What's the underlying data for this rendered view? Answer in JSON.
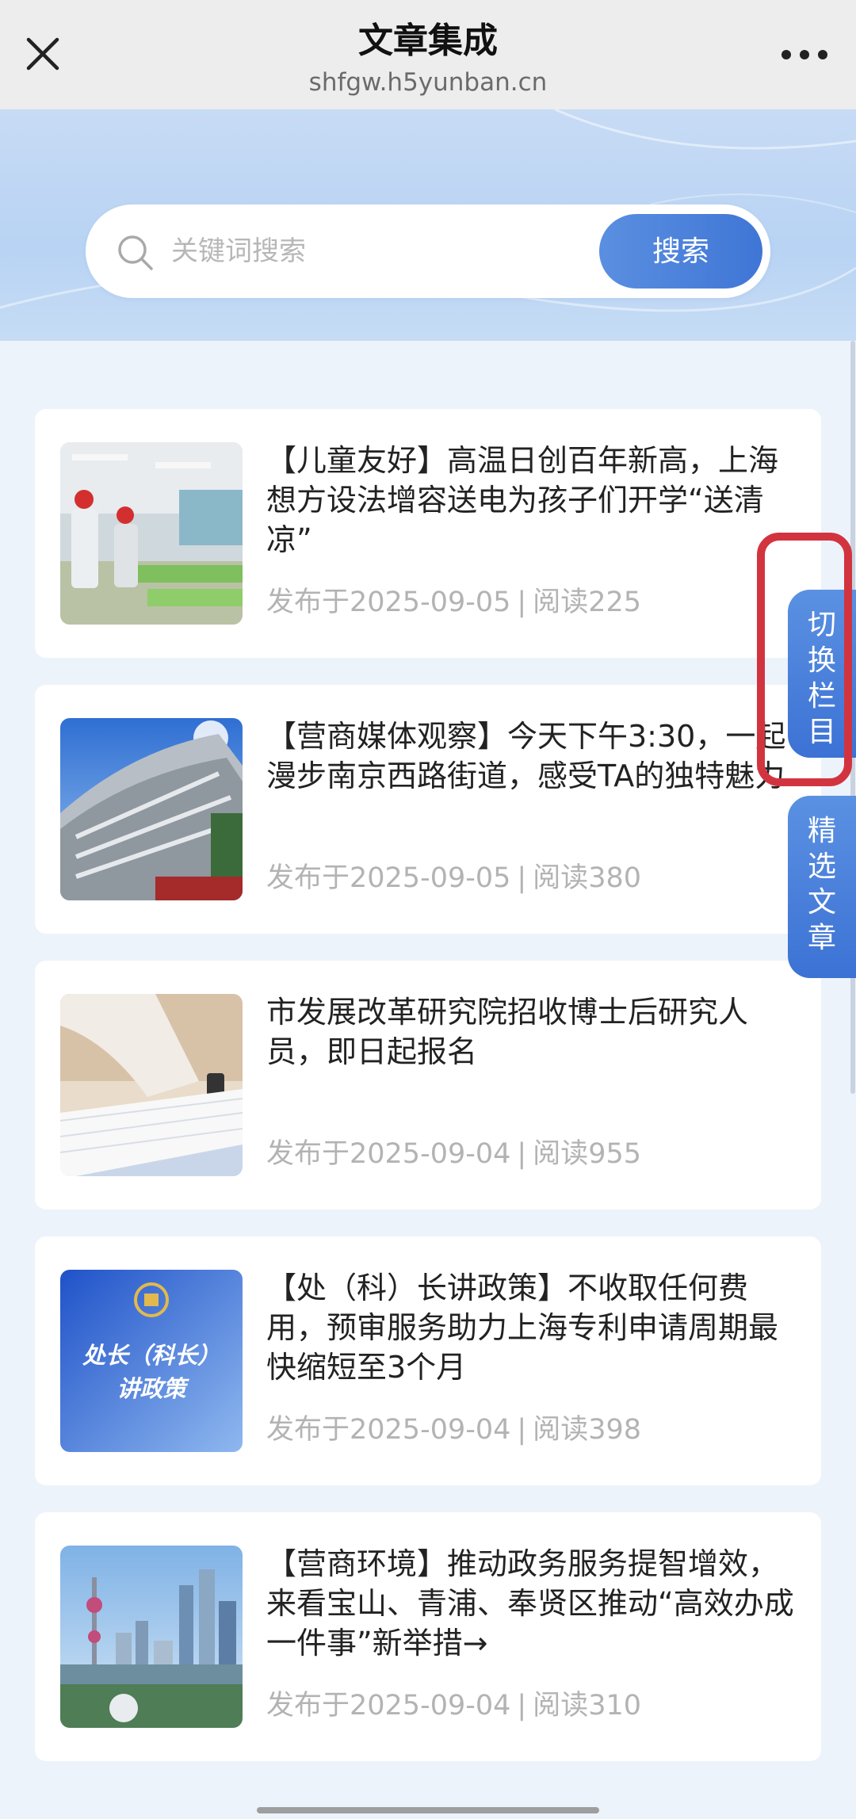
{
  "topbar": {
    "title": "文章集成",
    "url": "shfgw.h5yunban.cn"
  },
  "search": {
    "placeholder": "关键词搜索",
    "button_label": "搜索"
  },
  "articles": [
    {
      "title": "【儿童友好】高温日创百年新高，上海想方设法增容送电为孩子们开学“送清凉”",
      "published": "发布于2025-09-05",
      "reads": "阅读225",
      "thumb_icon": "workers-classroom-photo"
    },
    {
      "title": "【营商媒体观察】今天下午3:30，一起漫步南京西路街道，感受TA的独特魅力",
      "published": "发布于2025-09-05",
      "reads": "阅读380",
      "thumb_icon": "building-facade-photo"
    },
    {
      "title": "市发展改革研究院招收博士后研究人员，即日起报名",
      "published": "发布于2025-09-04",
      "reads": "阅读955",
      "thumb_icon": "signing-document-photo"
    },
    {
      "title": "【处（科）长讲政策】不收取任何费用，预审服务助力上海专利申请周期最快缩短至3个月",
      "published": "发布于2025-09-04",
      "reads": "阅读398",
      "thumb_icon": "policy-poster",
      "thumb_text": [
        "处长（科长）",
        "讲政策"
      ]
    },
    {
      "title": "【营商环境】推动政务服务提智增效，来看宝山、青浦、奉贤区推动“高效办成一件事”新举措→",
      "published": "发布于2025-09-04",
      "reads": "阅读310",
      "thumb_icon": "shanghai-skyline-photo"
    }
  ],
  "side_tabs": {
    "switch_column": [
      "切",
      "换",
      "栏",
      "目"
    ],
    "featured": [
      "精",
      "选",
      "文",
      "章"
    ]
  },
  "meta_separator": "|",
  "colors": {
    "accent": "#4a80dc",
    "highlight": "#d2343f",
    "meta_text": "#b3b3b3"
  }
}
